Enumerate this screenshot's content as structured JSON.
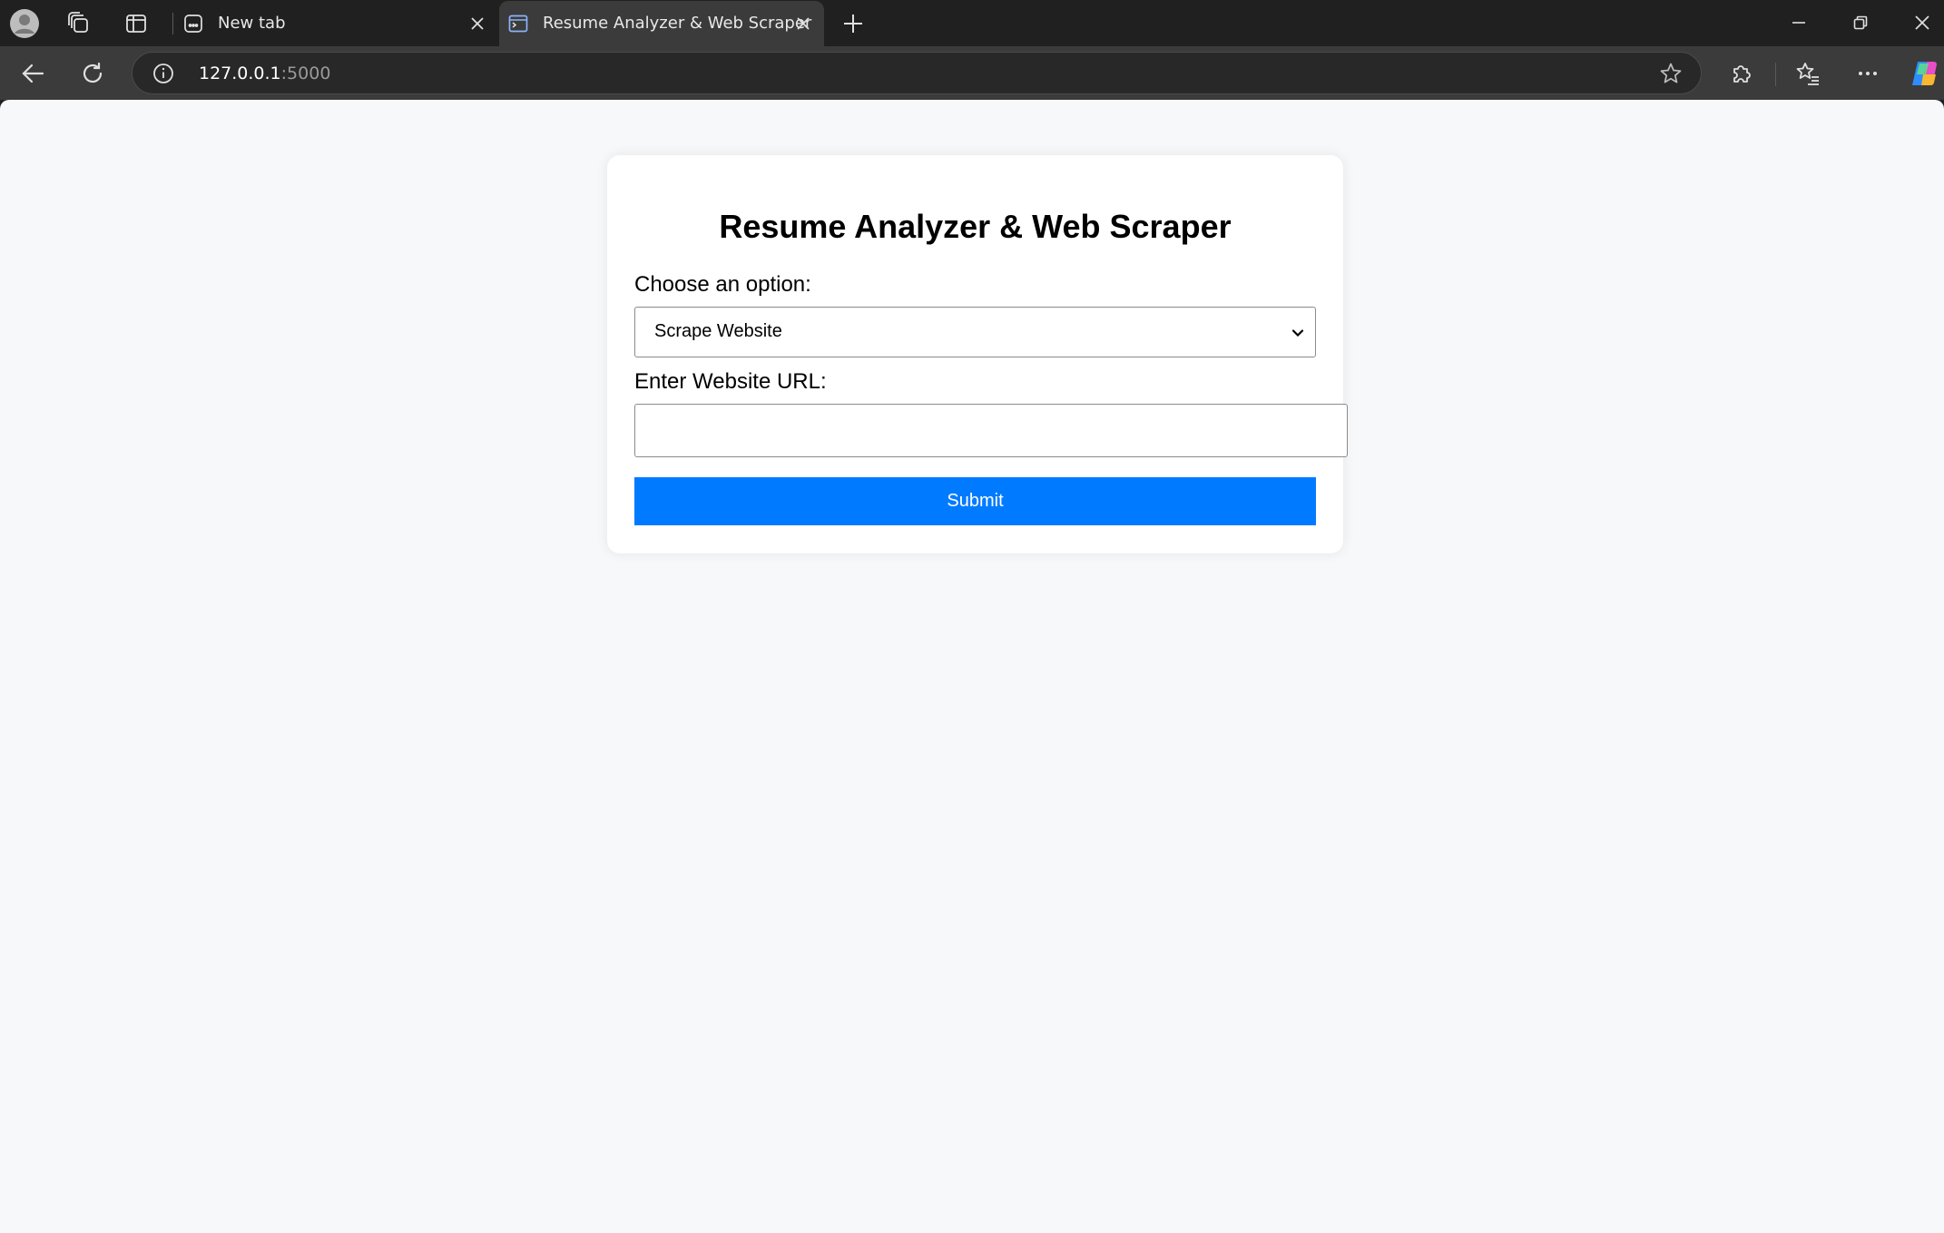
{
  "browser": {
    "tabs": [
      {
        "title": "New tab",
        "active": false
      },
      {
        "title": "Resume Analyzer & Web Scraper",
        "active": true
      }
    ],
    "address": {
      "host": "127.0.0.1",
      "port": ":5000"
    }
  },
  "icons": {
    "profile": "profile-avatar-icon",
    "workspaces": "workspaces-icon",
    "tab_actions": "vertical-tabs-icon",
    "back": "back-arrow-icon",
    "refresh": "refresh-icon",
    "site_info": "info-icon",
    "favorite": "star-icon",
    "extensions": "puzzle-icon",
    "favorites": "favorites-list-icon",
    "more": "more-dots-icon",
    "copilot": "copilot-icon"
  },
  "page": {
    "heading": "Resume Analyzer & Web Scraper",
    "option_label": "Choose an option:",
    "option_selected": "Scrape Website",
    "url_label": "Enter Website URL:",
    "url_value": "",
    "submit_label": "Submit"
  },
  "colors": {
    "accent": "#007bff",
    "page_bg": "#f7f8fa",
    "chrome_dark": "#202020",
    "toolbar": "#3b3b3b"
  }
}
